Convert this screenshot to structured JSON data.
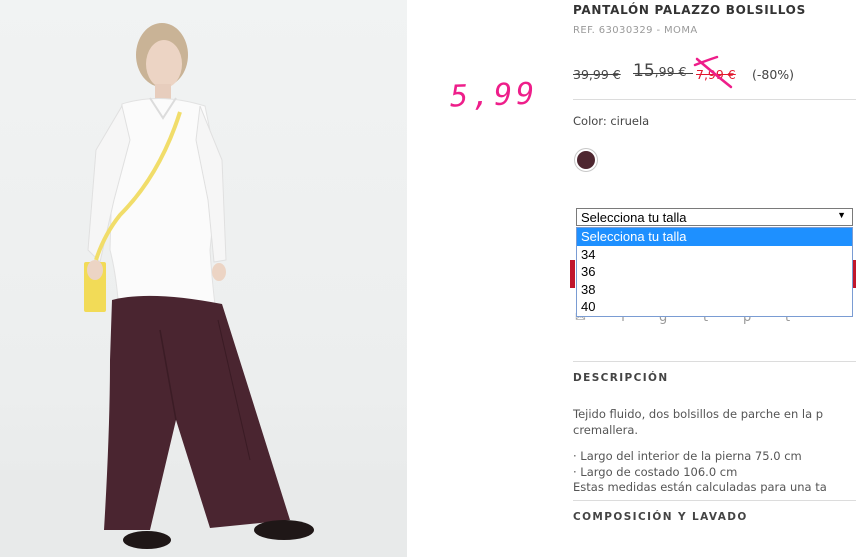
{
  "product": {
    "title": "PANTALÓN PALAZZO BOLSILLOS",
    "ref": "REF. 63030329 - MOMA",
    "price_original": "39,99 €",
    "price_previous_main": "15",
    "price_previous_cents": ",99 €",
    "price_sale": "7,99 €",
    "discount": "(-80%)",
    "handwritten_price": "5,99",
    "color_label": "Color: ciruela",
    "swatch_color": "#4e2630"
  },
  "size_select": {
    "selected": "Selecciona tu talla",
    "options": [
      "Selecciona tu talla",
      "34",
      "36",
      "38",
      "40"
    ]
  },
  "share_icons": [
    "email-icon",
    "facebook-icon",
    "google-plus-icon",
    "twitter-icon",
    "pinterest-icon",
    "tumblr-icon"
  ],
  "description": {
    "heading": "DESCRIPCIÓN",
    "line1": "Tejido fluido, dos bolsillos de parche en la p",
    "line2": "cremallera.",
    "line3": "· Largo del interior de la pierna 75.0 cm",
    "line4": "· Largo de costado 106.0 cm",
    "line5": "Estas medidas están calculadas para una ta"
  },
  "composition_heading": "COMPOSICIÓN Y LAVADO"
}
